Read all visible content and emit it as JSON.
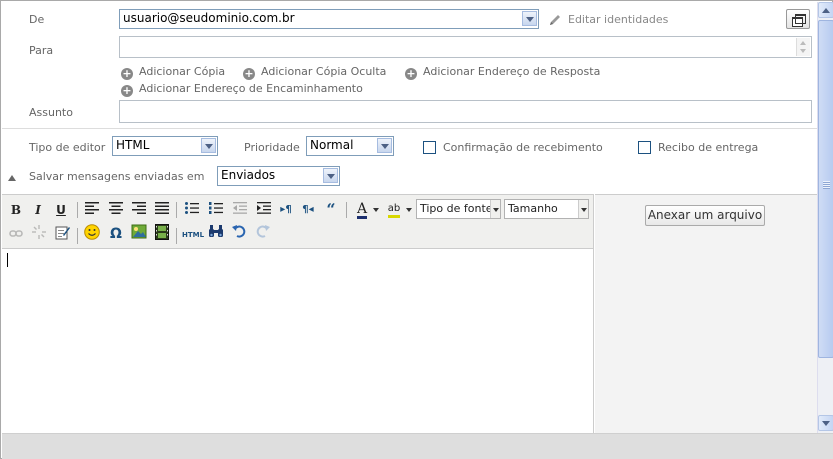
{
  "from": {
    "label": "De",
    "value": "usuario@seudominio.com.br",
    "edit_identities": "Editar identidades"
  },
  "to": {
    "label": "Para",
    "value": ""
  },
  "add_links": {
    "cc": "Adicionar Cópia",
    "bcc": "Adicionar Cópia Oculta",
    "reply_to": "Adicionar Endereço de Resposta",
    "forward_to": "Adicionar Endereço de Encaminhamento"
  },
  "subject": {
    "label": "Assunto",
    "value": ""
  },
  "options": {
    "editor_type_label": "Tipo de editor",
    "editor_type_value": "HTML",
    "priority_label": "Prioridade",
    "priority_value": "Normal",
    "read_receipt_label": "Confirmação de recebimento",
    "delivery_receipt_label": "Recibo de entrega",
    "save_sent_label": "Salvar mensagens enviadas em",
    "save_sent_value": "Enviados"
  },
  "toolbar": {
    "bold": "B",
    "italic": "I",
    "underline": "U",
    "font_family_placeholder": "Tipo de fonte",
    "font_size_placeholder": "Tamanho",
    "html_label": "HTML",
    "omega": "Ω",
    "quote": "“",
    "font_color_letter": "A",
    "highlight_letters": "ab"
  },
  "attachments": {
    "button_label": "Anexar um arquivo"
  },
  "colors": {
    "accent": "#1c5180",
    "toolbar_bg": "#f0f0ee",
    "attach_bg": "#f3f3f3"
  }
}
